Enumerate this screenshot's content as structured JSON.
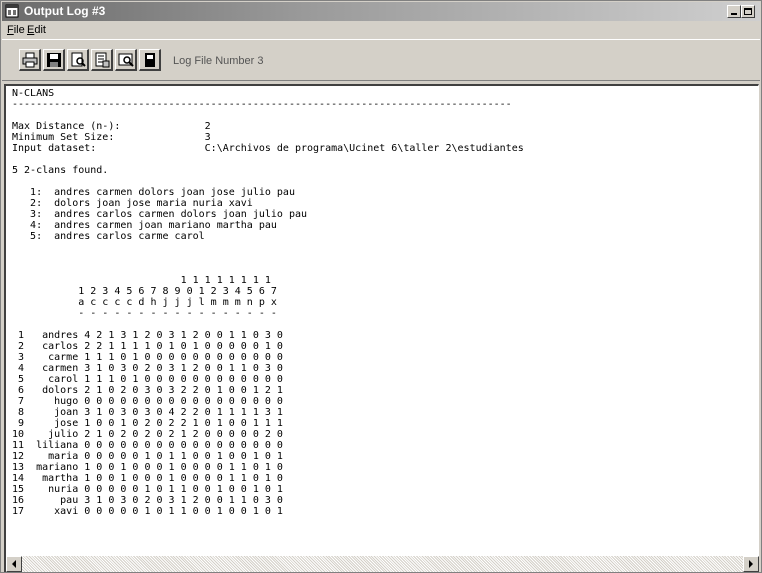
{
  "window": {
    "title": "Output Log #3",
    "controls": [
      "minimize-icon",
      "maximize-icon"
    ]
  },
  "menu": {
    "file": {
      "accel": "F",
      "rest": "ile"
    },
    "edit": {
      "accel": "E",
      "rest": "dit"
    }
  },
  "toolbar": {
    "buttons": [
      "print-icon",
      "save-icon",
      "find-icon",
      "print-preview-icon",
      "preview-icon",
      "delete-icon"
    ],
    "label": "Log File Number 3"
  },
  "log": {
    "heading": "N-CLANS",
    "rule": "-----------------------------------------------------------------------------------",
    "params": [
      "Max Distance (n-):              2",
      "Minimum Set Size:               3",
      "Input dataset:                  C:\\Archivos de programa\\Ucinet 6\\taller 2\\estudiantes"
    ],
    "found": "5 2-clans found.",
    "clans": [
      "   1:  andres carmen dolors joan jose julio pau",
      "   2:  dolors joan jose maria nuria xavi",
      "   3:  andres carlos carmen dolors joan julio pau",
      "   4:  andres carmen joan mariano martha pau",
      "   5:  andres carlos carme carol"
    ],
    "matrix_header": [
      "                            1 1 1 1 1 1 1 1",
      "           1 2 3 4 5 6 7 8 9 0 1 2 3 4 5 6 7",
      "           a c c c c d h j j j l m m m n p x",
      "           - - - - - - - - - - - - - - - - -"
    ],
    "matrix_rows": [
      " 1   andres 4 2 1 3 1 2 0 3 1 2 0 0 1 1 0 3 0",
      " 2   carlos 2 2 1 1 1 1 0 1 0 1 0 0 0 0 0 1 0",
      " 3    carme 1 1 1 0 1 0 0 0 0 0 0 0 0 0 0 0 0",
      " 4   carmen 3 1 0 3 0 2 0 3 1 2 0 0 1 1 0 3 0",
      " 5    carol 1 1 1 0 1 0 0 0 0 0 0 0 0 0 0 0 0",
      " 6   dolors 2 1 0 2 0 3 0 3 2 2 0 1 0 0 1 2 1",
      " 7     hugo 0 0 0 0 0 0 0 0 0 0 0 0 0 0 0 0 0",
      " 8     joan 3 1 0 3 0 3 0 4 2 2 0 1 1 1 1 3 1",
      " 9     jose 1 0 0 1 0 2 0 2 2 1 0 1 0 0 1 1 1",
      "10    julio 2 1 0 2 0 2 0 2 1 2 0 0 0 0 0 2 0",
      "11  liliana 0 0 0 0 0 0 0 0 0 0 0 0 0 0 0 0 0",
      "12    maria 0 0 0 0 0 1 0 1 1 0 0 1 0 0 1 0 1",
      "13  mariano 1 0 0 1 0 0 0 1 0 0 0 0 1 1 0 1 0",
      "14   martha 1 0 0 1 0 0 0 1 0 0 0 0 1 1 0 1 0",
      "15    nuria 0 0 0 0 0 1 0 1 1 0 0 1 0 0 1 0 1",
      "16      pau 3 1 0 3 0 2 0 3 1 2 0 0 1 1 0 3 0",
      "17     xavi 0 0 0 0 0 1 0 1 1 0 0 1 0 0 1 0 1"
    ]
  },
  "scrollbar": {
    "left_icon": "scroll-left-icon",
    "right_icon": "scroll-right-icon"
  },
  "colors": {
    "face": "#d4d0c8",
    "title_start": "#6b6b6b",
    "title_end": "#cfcfcf",
    "content_bg": "#ffffff"
  }
}
